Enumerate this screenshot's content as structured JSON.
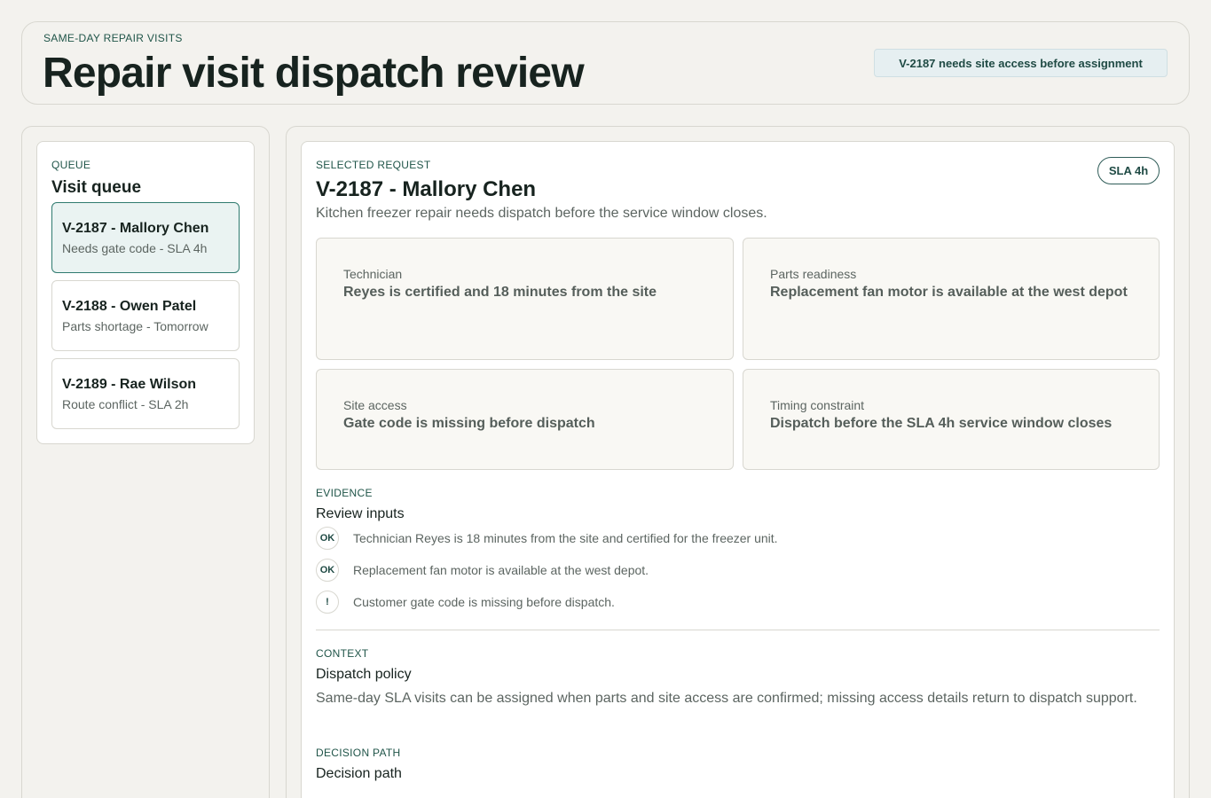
{
  "header": {
    "eyebrow": "SAME-DAY REPAIR VISITS",
    "title": "Repair visit dispatch review",
    "alert": "V-2187 needs site access before assignment"
  },
  "queue": {
    "eyebrow": "QUEUE",
    "title": "Visit queue",
    "items": [
      {
        "title": "V-2187 - Mallory Chen",
        "subtitle": "Needs gate code - SLA 4h",
        "active": true
      },
      {
        "title": "V-2188 - Owen Patel",
        "subtitle": "Parts shortage - Tomorrow",
        "active": false
      },
      {
        "title": "V-2189 - Rae Wilson",
        "subtitle": "Route conflict - SLA 2h",
        "active": false
      }
    ]
  },
  "request": {
    "eyebrow": "SELECTED REQUEST",
    "title": "V-2187 - Mallory Chen",
    "description": "Kitchen freezer repair needs dispatch before the service window closes.",
    "badge": "SLA 4h",
    "cards": [
      {
        "label": "Technician",
        "value": "Reyes is certified and 18 minutes from the site"
      },
      {
        "label": "Parts readiness",
        "value": "Replacement fan motor is available at the west depot"
      },
      {
        "label": "Site access",
        "value": "Gate code is missing before dispatch"
      },
      {
        "label": "Timing constraint",
        "value": "Dispatch before the SLA 4h service window closes"
      }
    ]
  },
  "evidence": {
    "eyebrow": "EVIDENCE",
    "title": "Review inputs",
    "items": [
      {
        "icon": "OK",
        "icon_name": "ok-check-icon",
        "text": "Technician Reyes is 18 minutes from the site and certified for the freezer unit."
      },
      {
        "icon": "OK",
        "icon_name": "ok-check-icon",
        "text": "Replacement fan motor is available at the west depot."
      },
      {
        "icon": "!",
        "icon_name": "warning-icon",
        "text": "Customer gate code is missing before dispatch."
      }
    ]
  },
  "context": {
    "eyebrow": "CONTEXT",
    "title": "Dispatch policy",
    "text": "Same-day SLA visits can be assigned when parts and site access are confirmed; missing access details return to dispatch support."
  },
  "decision": {
    "eyebrow": "DECISION PATH",
    "title": "Decision path"
  },
  "colors": {
    "accent": "#1f6c61",
    "active_queue_bg": "#eaf3f2",
    "alert_bg": "#e6eff1",
    "page_bg": "#f3f2ee"
  }
}
